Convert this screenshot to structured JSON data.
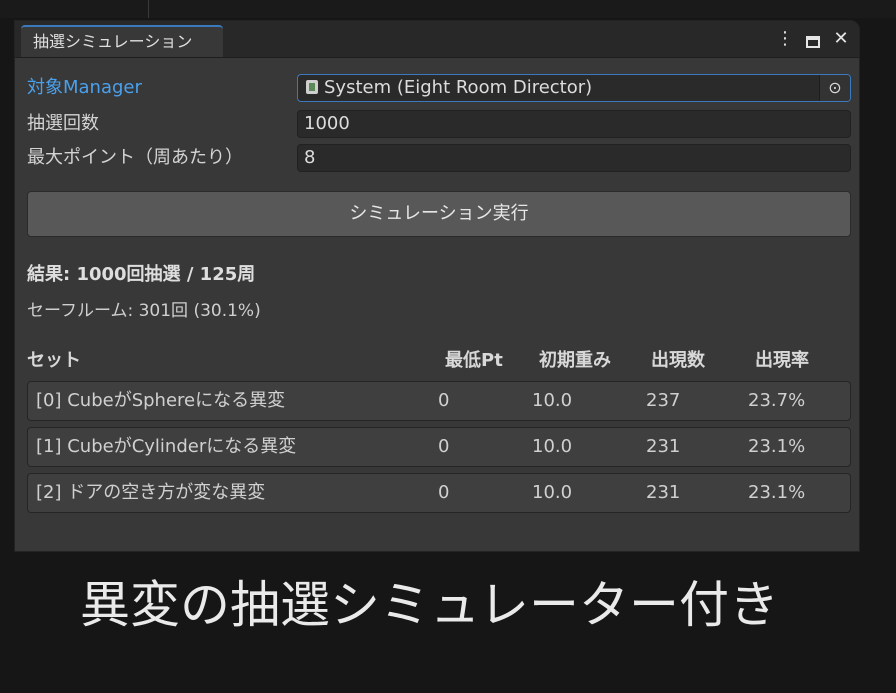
{
  "window": {
    "tab_title": "抽選シミュレーション",
    "actions": {
      "menu_icon": "kebab-menu-icon",
      "maximize_icon": "maximize-icon",
      "close_icon": "close-icon",
      "menu_glyph": "⋮",
      "close_glyph": "✕"
    }
  },
  "fields": {
    "target_manager": {
      "label": "対象Manager",
      "value": "System (Eight Room Director)",
      "picker_glyph": "⊙"
    },
    "draw_count": {
      "label": "抽選回数",
      "value": "1000"
    },
    "max_points": {
      "label": "最大ポイント（周あたり）",
      "value": "8"
    }
  },
  "run_button": {
    "label": "シミュレーション実行"
  },
  "results": {
    "summary": "結果: 1000回抽選 / 125周",
    "safe_room": "セーフルーム: 301回 (30.1%)"
  },
  "table": {
    "headers": {
      "set": "セット",
      "min_pt": "最低Pt",
      "initial_weight": "初期重み",
      "appearances": "出現数",
      "rate": "出現率"
    },
    "rows": [
      {
        "set": "[0] CubeがSphereになる異変",
        "min_pt": "0",
        "initial_weight": "10.0",
        "appearances": "237",
        "rate": "23.7%"
      },
      {
        "set": "[1] CubeがCylinderになる異変",
        "min_pt": "0",
        "initial_weight": "10.0",
        "appearances": "231",
        "rate": "23.1%"
      },
      {
        "set": "[2] ドアの空き方が変な異変",
        "min_pt": "0",
        "initial_weight": "10.0",
        "appearances": "231",
        "rate": "23.1%"
      }
    ]
  },
  "caption": "異変の抽選シミュレーター付き",
  "colors": {
    "accent": "#3a79bb",
    "link": "#4aa0ec",
    "panel": "#383838",
    "background": "#161616"
  }
}
